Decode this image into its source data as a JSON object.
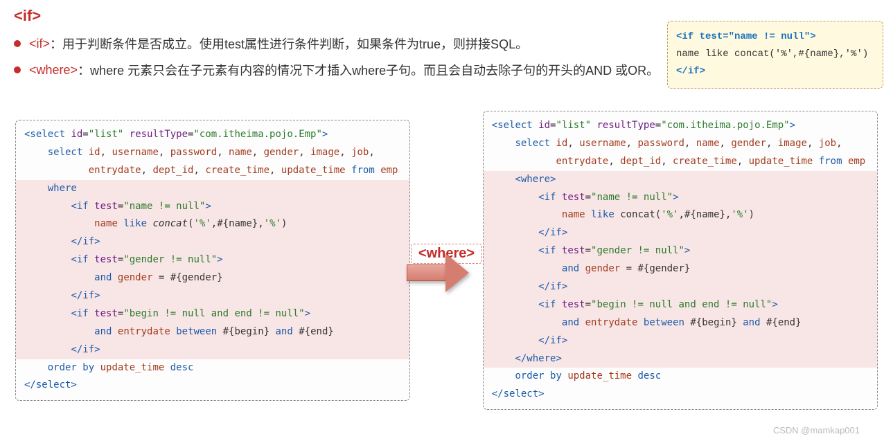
{
  "title": "<if>",
  "bullets": {
    "if": {
      "tag": "<if>",
      "text": "：用于判断条件是否成立。使用test属性进行条件判断，如果条件为true，则拼接SQL。"
    },
    "where": {
      "tag": "<where>",
      "text": "：where 元素只会在子元素有内容的情况下才插入where子句。而且会自动去除子句的开头的AND 或OR。"
    }
  },
  "callout": {
    "line1a": "<if",
    "line1b": "  test=\"name != null\">",
    "line2": "      name like concat('%',#{name},'%')",
    "line3": "</if>"
  },
  "arrow_label": "<where>",
  "code_left": {
    "l01": "<select id=\"list\" resultType=\"com.itheima.pojo.Emp\">",
    "l02": "    select id, username, password, name, gender, image, job,",
    "l03": "           entrydate, dept_id, create_time, update_time from emp",
    "l04": "    where",
    "l05": "        <if test=\"name != null\">",
    "l06": "            name like concat('%',#{name},'%')",
    "l07": "        </if>",
    "l08": "        <if test=\"gender != null\">",
    "l09": "            and gender = #{gender}",
    "l10": "        </if>",
    "l11": "        <if test=\"begin != null and end != null\">",
    "l12": "            and entrydate between #{begin} and #{end}",
    "l13": "        </if>",
    "l14": "    order by update_time desc",
    "l15": "</select>"
  },
  "code_right": {
    "l01": "<select id=\"list\" resultType=\"com.itheima.pojo.Emp\">",
    "l02": "    select id, username, password, name, gender, image, job,",
    "l03": "           entrydate, dept_id, create_time, update_time from emp",
    "l04": "    <where>",
    "l05": "        <if test=\"name != null\">",
    "l06": "            name like concat('%',#{name},'%')",
    "l07": "        </if>",
    "l08": "        <if test=\"gender != null\">",
    "l09": "            and gender = #{gender}",
    "l10": "        </if>",
    "l11": "        <if test=\"begin != null and end != null\">",
    "l12": "            and entrydate between #{begin} and #{end}",
    "l13": "        </if>",
    "l14": "    </where>",
    "l15": "    order by update_time desc",
    "l16": "</select>"
  },
  "watermark": "CSDN @mamkap001"
}
